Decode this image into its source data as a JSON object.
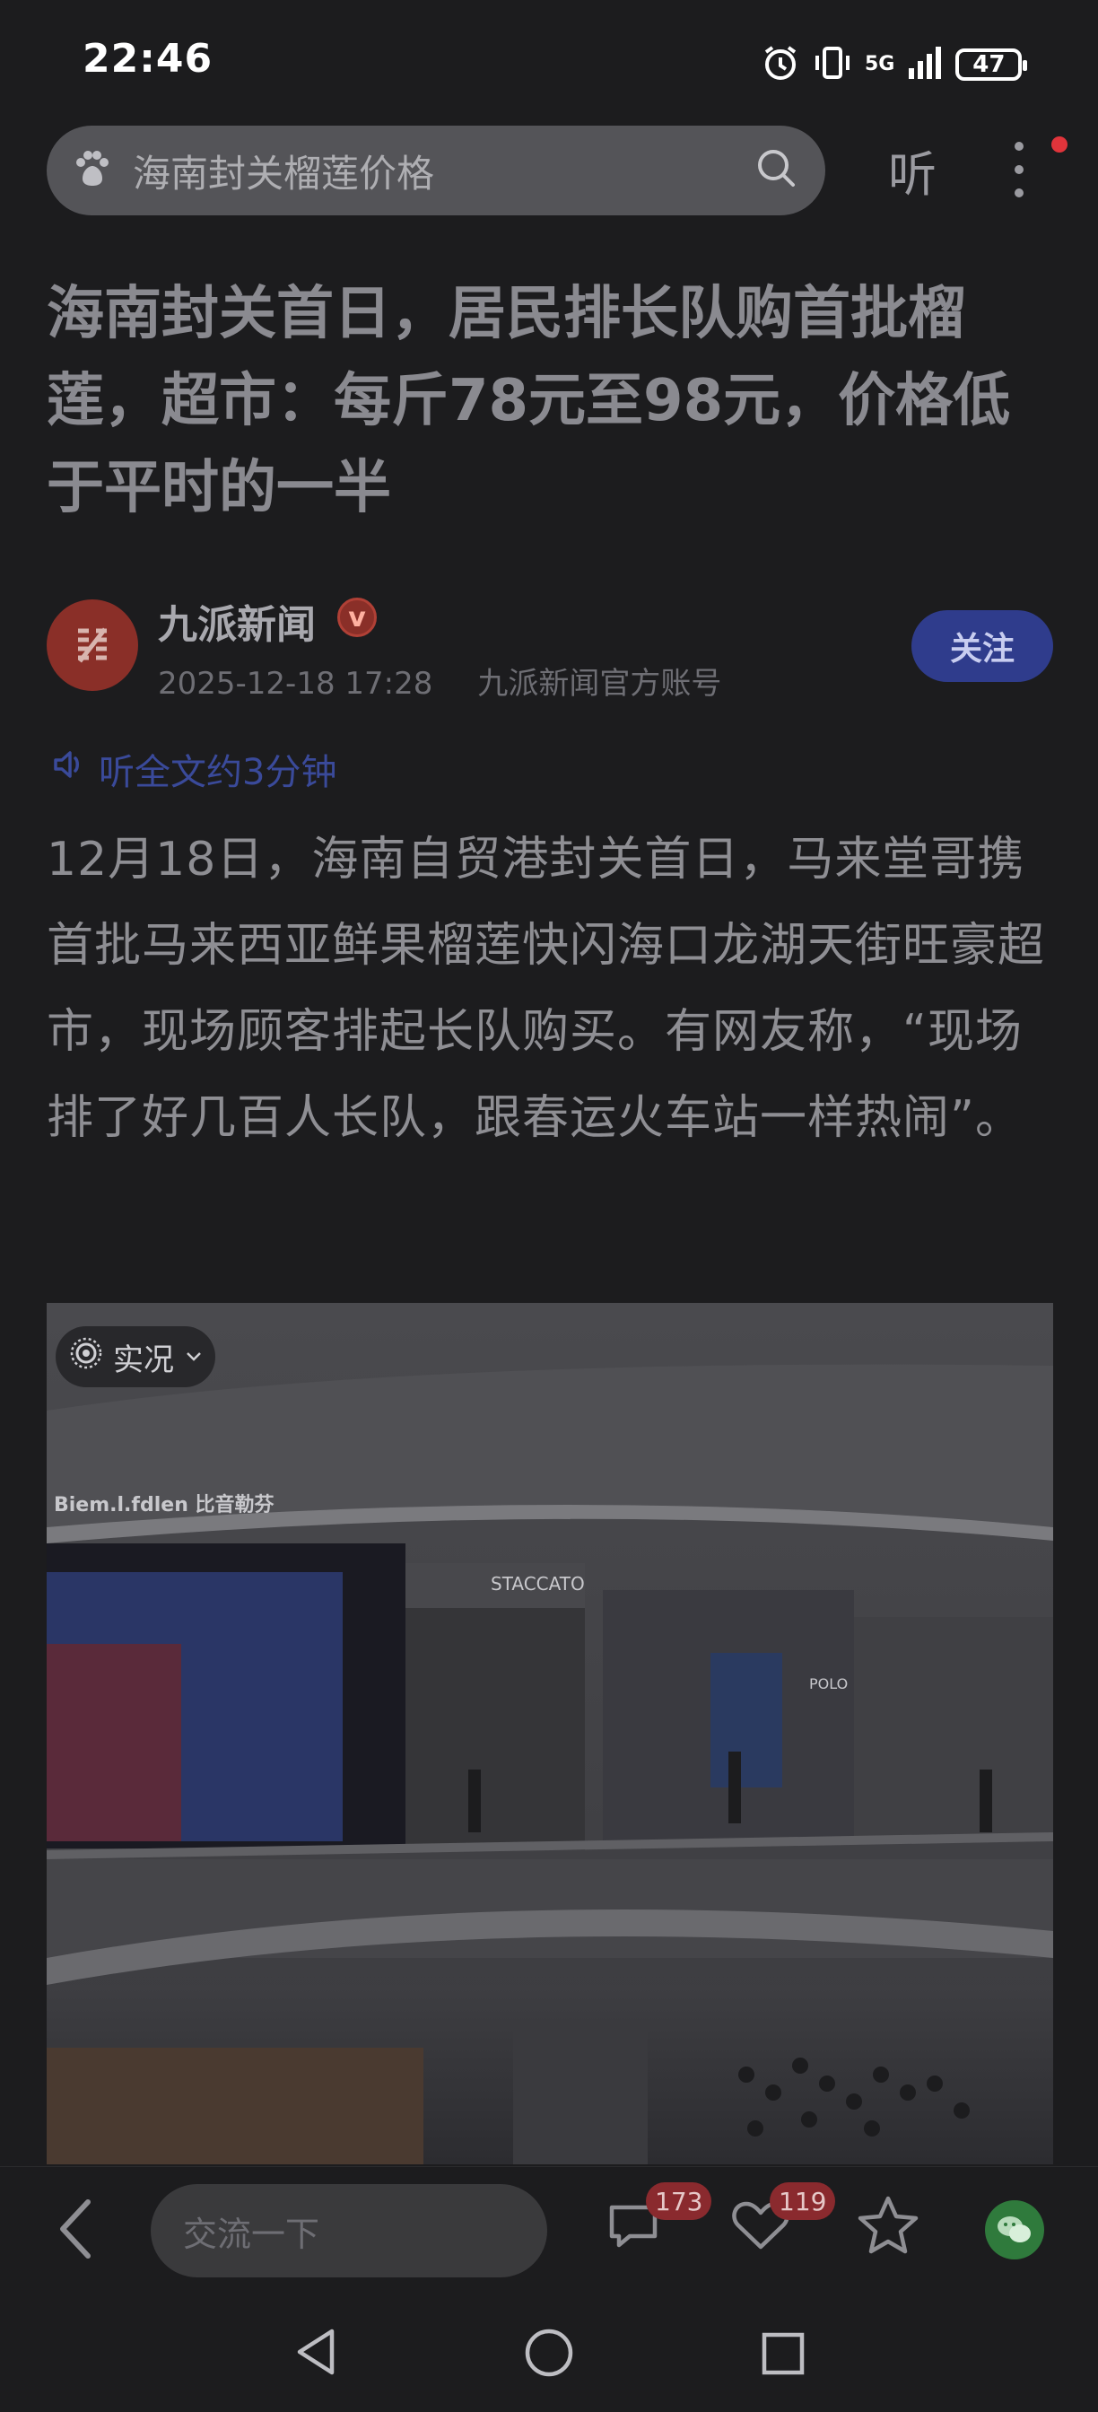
{
  "status_bar": {
    "time": "22:46",
    "network": "5G",
    "battery": "47",
    "icons": [
      "alarm-icon",
      "vibrate-icon",
      "5g-icon",
      "signal-icon",
      "battery-icon"
    ]
  },
  "search": {
    "logo_icon": "paw-icon",
    "query": "海南封关榴莲价格",
    "search_icon": "search-icon",
    "listen_label": "听",
    "more_icon": "more-vertical-icon"
  },
  "article": {
    "headline": "海南封关首日，居民排长队购首批榴莲，超市：每斤78元至98元，价格低于平时的一半",
    "author": {
      "name": "九派新闻",
      "verified_mark": "v",
      "datetime": "2025-12-18 17:28",
      "account_desc": "九派新闻官方账号",
      "follow_label": "关注"
    },
    "listen_text": "听全文约3分钟",
    "body": "12月18日，海南自贸港封关首日，马来堂哥携首批马来西亚鲜果榴莲快闪海口龙湖天街旺豪超市，现场顾客排起长队购买。有网友称，“现场排了好几百人长队，跟春运火车站一样热闹”。",
    "image": {
      "live_label": "实况",
      "store_signs": [
        "Biem.l.fdlen 比音勒芬",
        "STACCATO",
        "POLO"
      ]
    }
  },
  "bottom_bar": {
    "comment_placeholder": "交流一下",
    "comment_count": "173",
    "like_count": "119"
  },
  "colors": {
    "background": "#1c1c1e",
    "accent_blue": "#2f3c8c",
    "badge_red": "#8a2a2e",
    "avatar_red": "#8a2f28",
    "wechat_green": "#2f7a3c"
  }
}
